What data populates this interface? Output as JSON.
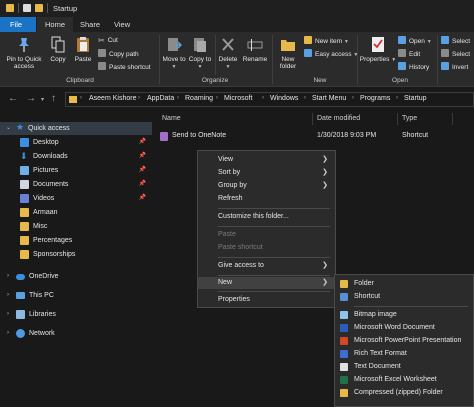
{
  "window": {
    "title": "Startup"
  },
  "tabs": [
    "File",
    "Home",
    "Share",
    "View"
  ],
  "ribbon": {
    "clipboard": {
      "pin_label": "Pin to Quick access",
      "copy_label": "Copy",
      "paste_label": "Paste",
      "cut_label": "Cut",
      "copy_path_label": "Copy path",
      "paste_shortcut_label": "Paste shortcut",
      "group_label": "Clipboard"
    },
    "organize": {
      "move_to_label": "Move to",
      "copy_to_label": "Copy to",
      "delete_label": "Delete",
      "rename_label": "Rename",
      "group_label": "Organize"
    },
    "new": {
      "new_folder_label": "New folder",
      "new_item_label": "New item",
      "easy_access_label": "Easy access",
      "group_label": "New"
    },
    "open": {
      "properties_label": "Properties",
      "open_label": "Open",
      "edit_label": "Edit",
      "history_label": "History",
      "group_label": "Open"
    },
    "select": {
      "select_all_label": "Select",
      "select_none_label": "Select",
      "invert_label": "Invert"
    }
  },
  "address": {
    "crumbs": [
      "Aseem Kishore",
      "AppData",
      "Roaming",
      "Microsoft",
      "Windows",
      "Start Menu",
      "Programs",
      "Startup"
    ]
  },
  "nav": {
    "items": [
      {
        "label": "Quick access",
        "icon": "star-icon",
        "color": "#3c8fe0"
      },
      {
        "label": "Desktop",
        "icon": "desktop-icon",
        "color": "#3c8fe0"
      },
      {
        "label": "Downloads",
        "icon": "download-icon",
        "color": "#3c8fe0"
      },
      {
        "label": "Pictures",
        "icon": "pictures-icon",
        "color": "#6fb0e8"
      },
      {
        "label": "Documents",
        "icon": "documents-icon",
        "color": "#cfd6de"
      },
      {
        "label": "Videos",
        "icon": "videos-icon",
        "color": "#6a7fd8"
      },
      {
        "label": "Armaan",
        "icon": "folder-icon",
        "color": "#e6b94a"
      },
      {
        "label": "Misc",
        "icon": "folder-icon",
        "color": "#e6b94a"
      },
      {
        "label": "Percentages",
        "icon": "folder-icon",
        "color": "#e6b94a"
      },
      {
        "label": "Sponsorships",
        "icon": "folder-icon",
        "color": "#e6b94a"
      },
      {
        "label": "OneDrive",
        "icon": "cloud-icon",
        "color": "#3c8fe0"
      },
      {
        "label": "This PC",
        "icon": "computer-icon",
        "color": "#5aa0e0"
      },
      {
        "label": "Libraries",
        "icon": "library-icon",
        "color": "#8fb8e0"
      },
      {
        "label": "Network",
        "icon": "network-icon",
        "color": "#4d9be0"
      }
    ]
  },
  "columns": {
    "name": "Name",
    "date": "Date modified",
    "type": "Type"
  },
  "files": [
    {
      "name": "Send to OneNote",
      "date": "1/30/2018 9:03 PM",
      "type": "Shortcut"
    }
  ],
  "context_menu": {
    "items": [
      {
        "label": "View",
        "submenu": true,
        "disabled": false
      },
      {
        "label": "Sort by",
        "submenu": true,
        "disabled": false
      },
      {
        "label": "Group by",
        "submenu": true,
        "disabled": false
      },
      {
        "label": "Refresh",
        "submenu": false,
        "disabled": false
      },
      {
        "label": "Customize this folder...",
        "submenu": false,
        "disabled": false
      },
      {
        "label": "Paste",
        "submenu": false,
        "disabled": true
      },
      {
        "label": "Paste shortcut",
        "submenu": false,
        "disabled": true
      },
      {
        "label": "Give access to",
        "submenu": true,
        "disabled": false
      },
      {
        "label": "New",
        "submenu": true,
        "disabled": false
      },
      {
        "label": "Properties",
        "submenu": false,
        "disabled": false
      }
    ]
  },
  "new_submenu": {
    "items": [
      {
        "label": "Folder",
        "icon": "folder-icon",
        "color": "#e6b94a"
      },
      {
        "label": "Shortcut",
        "icon": "shortcut-icon",
        "color": "#5a8fd8"
      },
      {
        "label": "Bitmap image",
        "icon": "bitmap-icon",
        "color": "#8fc4e8"
      },
      {
        "label": "Microsoft Word Document",
        "icon": "word-icon",
        "color": "#2b5cb8"
      },
      {
        "label": "Microsoft PowerPoint Presentation",
        "icon": "powerpoint-icon",
        "color": "#d24726"
      },
      {
        "label": "Rich Text Format",
        "icon": "rtf-icon",
        "color": "#3a6fd0"
      },
      {
        "label": "Text Document",
        "icon": "text-document-icon",
        "color": "#e0e0e0"
      },
      {
        "label": "Microsoft Excel Worksheet",
        "icon": "excel-icon",
        "color": "#217346"
      },
      {
        "label": "Compressed (zipped) Folder",
        "icon": "zip-folder-icon",
        "color": "#e6b94a"
      }
    ]
  }
}
